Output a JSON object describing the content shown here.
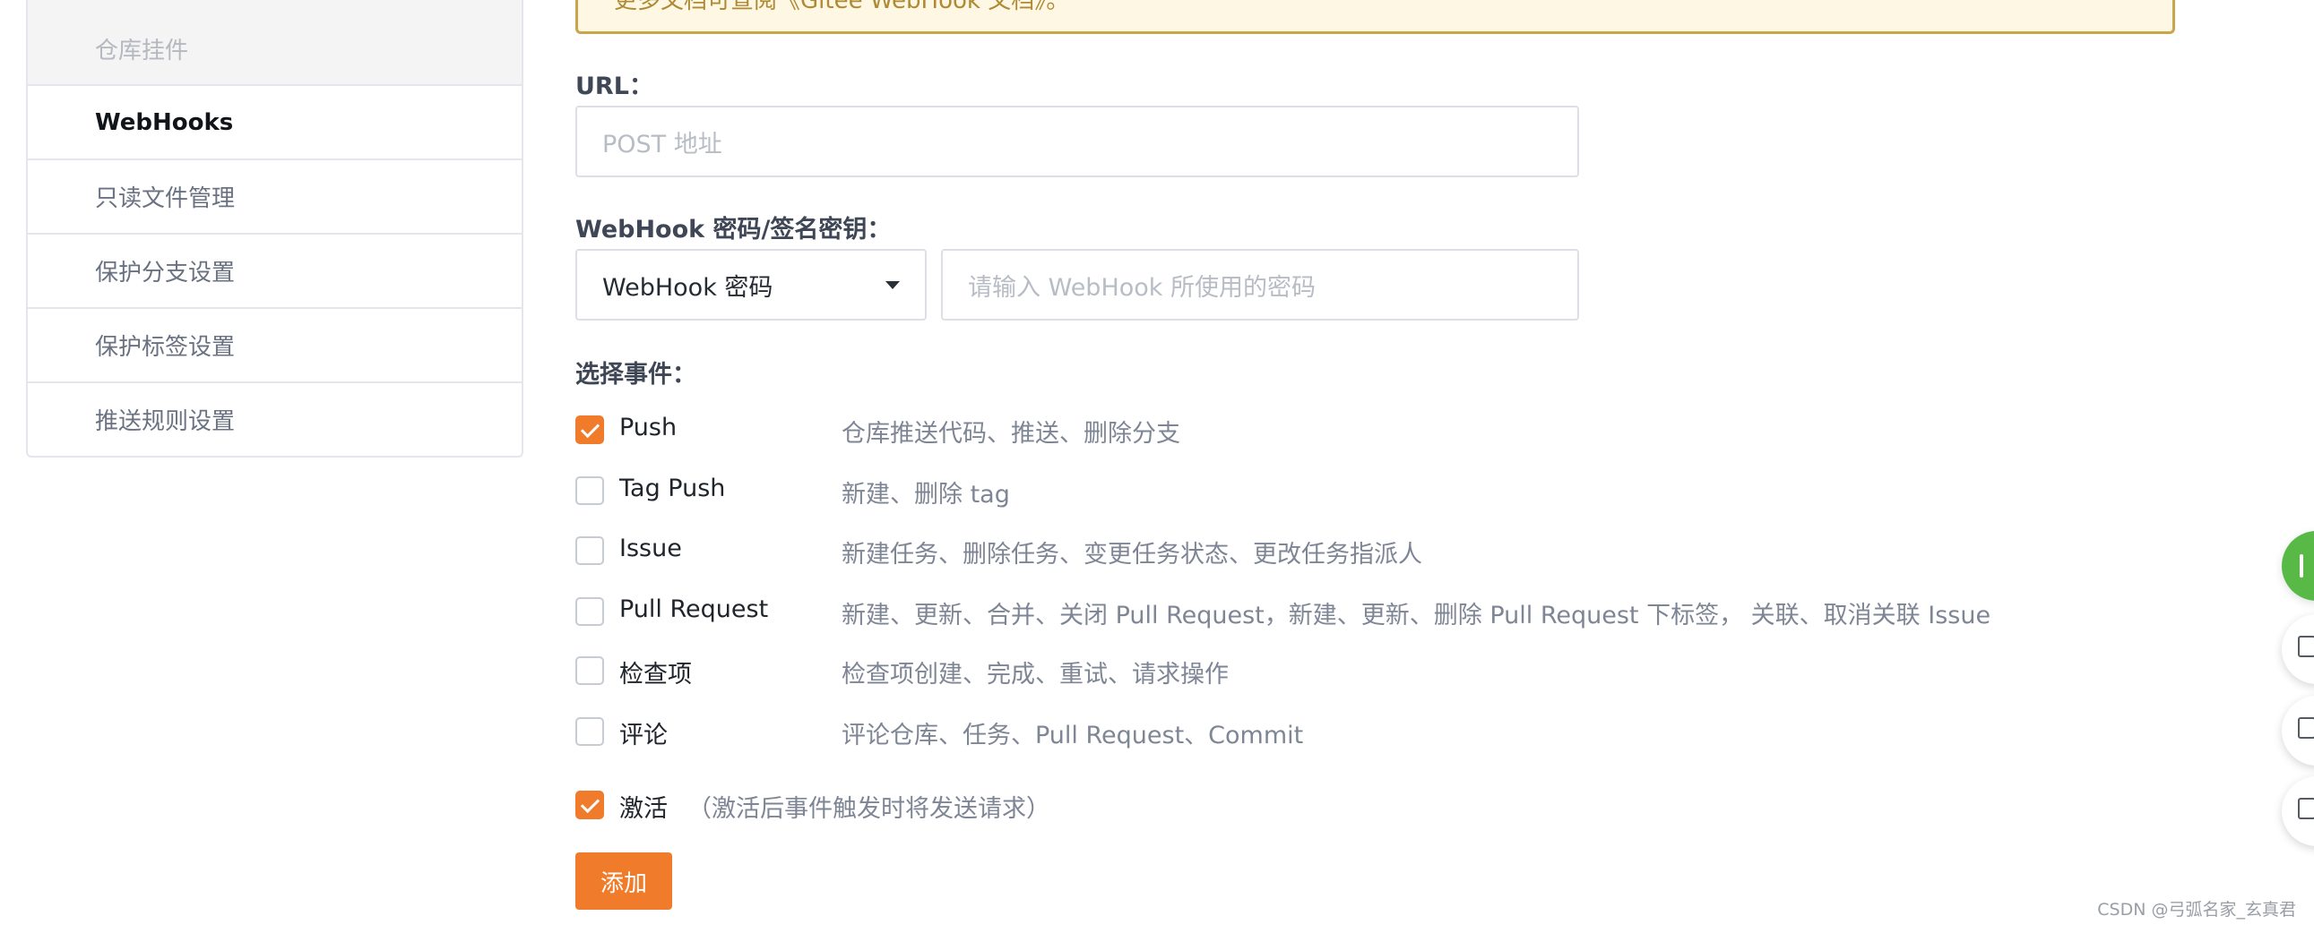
{
  "sidebar": {
    "items": [
      {
        "label": "仓库挂件"
      },
      {
        "label": "WebHooks"
      },
      {
        "label": "只读文件管理"
      },
      {
        "label": "保护分支设置"
      },
      {
        "label": "保护标签设置"
      },
      {
        "label": "推送规则设置"
      }
    ],
    "active_index": 1
  },
  "notice": {
    "text_prefix": "更多文档可查阅",
    "link_text": "《Gitee WebHook 文档》",
    "text_suffix": "。"
  },
  "form": {
    "url_label": "URL：",
    "url_placeholder": "POST 地址",
    "url_value": "",
    "secret_label": "WebHook 密码/签名密钥：",
    "secret_type_selected": "WebHook 密码",
    "secret_placeholder": "请输入 WebHook 所使用的密码",
    "secret_value": "",
    "events_label": "选择事件："
  },
  "events": [
    {
      "name": "Push",
      "description": "仓库推送代码、推送、删除分支",
      "checked": true
    },
    {
      "name": "Tag Push",
      "description": "新建、删除 tag",
      "checked": false
    },
    {
      "name": "Issue",
      "description": "新建任务、删除任务、变更任务状态、更改任务指派人",
      "checked": false
    },
    {
      "name": "Pull Request",
      "description": "新建、更新、合并、关闭 Pull Request，新建、更新、删除 Pull Request 下标签， 关联、取消关联 Issue",
      "checked": false
    },
    {
      "name": "检查项",
      "description": "检查项创建、完成、重试、请求操作",
      "checked": false
    },
    {
      "name": "评论",
      "description": "评论仓库、任务、Pull Request、Commit",
      "checked": false
    }
  ],
  "activate": {
    "label": "激活",
    "hint": "（激活后事件触发时将发送请求）",
    "checked": true
  },
  "submit": {
    "label": "添加"
  },
  "colors": {
    "accent": "#f07c2b",
    "float_green": "#58b946"
  },
  "floating_buttons": [
    {
      "icon": "plus-icon"
    },
    {
      "icon": "document-icon"
    },
    {
      "icon": "message-icon"
    },
    {
      "icon": "text-icon"
    }
  ],
  "watermark": "CSDN @弓弧名家_玄真君"
}
